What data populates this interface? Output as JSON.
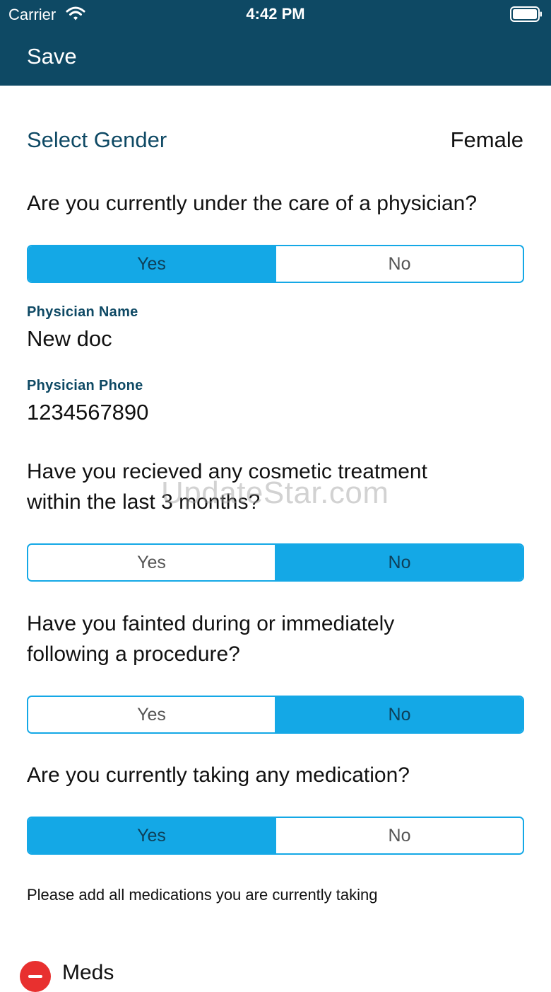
{
  "status_bar": {
    "carrier": "Carrier",
    "time": "4:42 PM",
    "wifi_icon": "wifi-icon",
    "battery_icon": "battery-icon"
  },
  "nav": {
    "save_label": "Save"
  },
  "gender": {
    "label": "Select Gender",
    "value": "Female"
  },
  "questions": [
    {
      "text": "Are you currently under the care of a physician?",
      "options": [
        "Yes",
        "No"
      ],
      "selected": "Yes"
    },
    {
      "text": "Have you recieved any cosmetic treatment within the last 3 months?",
      "options": [
        "Yes",
        "No"
      ],
      "selected": "No"
    },
    {
      "text": "Have you fainted during or immediately following a procedure?",
      "options": [
        "Yes",
        "No"
      ],
      "selected": "No"
    },
    {
      "text": "Are you currently taking any medication?",
      "options": [
        "Yes",
        "No"
      ],
      "selected": "Yes"
    }
  ],
  "physician": {
    "name_label": "Physician Name",
    "name_value": "New doc",
    "phone_label": "Physician Phone",
    "phone_value": "1234567890"
  },
  "medications": {
    "note": "Please add all medications you are currently taking",
    "items": [
      {
        "name": "Meds",
        "remove_icon": "remove-circle-icon"
      }
    ]
  },
  "watermark": "UpdateStar.com",
  "colors": {
    "header": "#0e4964",
    "accent": "#14a8e6",
    "remove": "#e8302f"
  }
}
